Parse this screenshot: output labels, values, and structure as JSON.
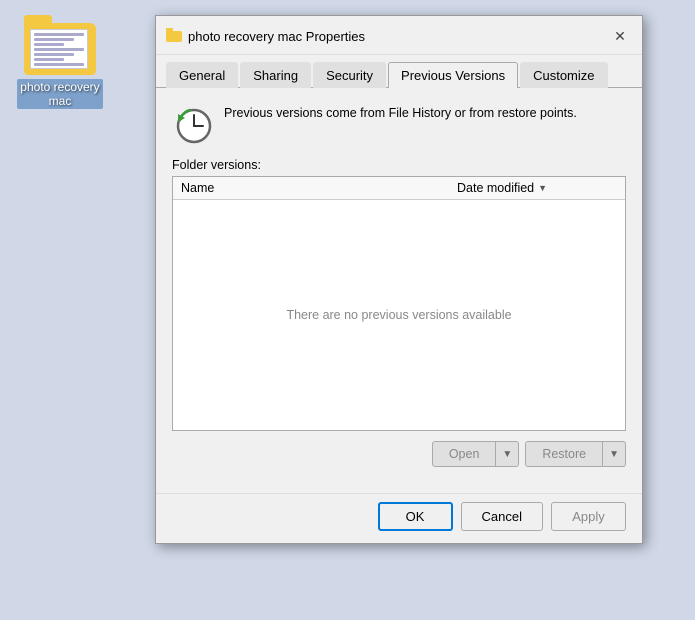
{
  "desktop": {
    "background": "#d0d8e8"
  },
  "folder_icon": {
    "label_line1": "photo recovery",
    "label_line2": "mac"
  },
  "dialog": {
    "title": "photo recovery mac Properties",
    "close_label": "✕",
    "tabs": [
      {
        "id": "general",
        "label": "General"
      },
      {
        "id": "sharing",
        "label": "Sharing"
      },
      {
        "id": "security",
        "label": "Security"
      },
      {
        "id": "previous_versions",
        "label": "Previous Versions",
        "active": true
      },
      {
        "id": "customize",
        "label": "Customize"
      }
    ],
    "info_text": "Previous versions come from File History or from restore points.",
    "section_label": "Folder versions:",
    "table": {
      "col_name": "Name",
      "col_date": "Date modified",
      "empty_message": "There are no previous versions available"
    },
    "open_button": "Open",
    "restore_button": "Restore",
    "ok_button": "OK",
    "cancel_button": "Cancel",
    "apply_button": "Apply"
  }
}
